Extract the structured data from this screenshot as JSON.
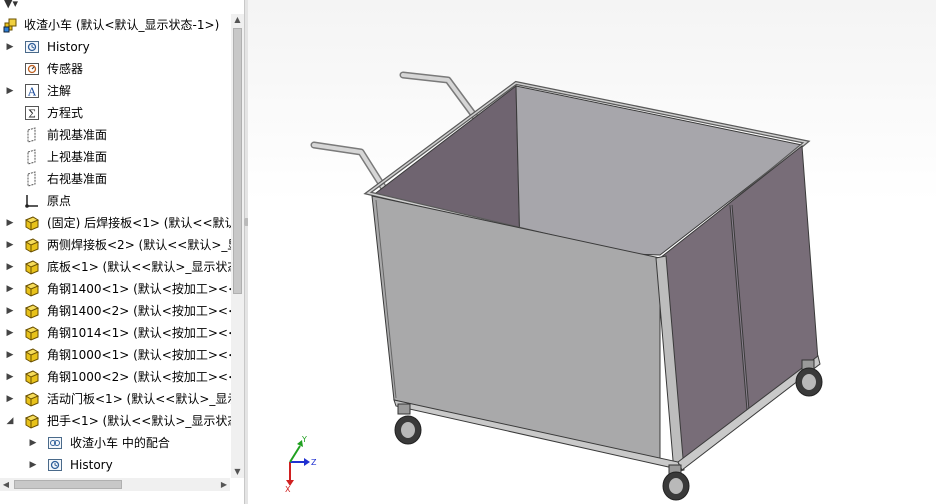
{
  "tree": {
    "root_label": "收渣小车  (默认<默认_显示状态-1>)",
    "items": [
      {
        "label": "History",
        "icon": "history-icon",
        "expander": true
      },
      {
        "label": "传感器",
        "icon": "sensor-icon",
        "expander": false
      },
      {
        "label": "注解",
        "icon": "annotation-icon",
        "expander": true
      },
      {
        "label": "方程式",
        "icon": "equation-icon",
        "expander": false
      },
      {
        "label": "前视基准面",
        "icon": "plane-icon",
        "expander": false
      },
      {
        "label": "上视基准面",
        "icon": "plane-icon",
        "expander": false
      },
      {
        "label": "右视基准面",
        "icon": "plane-icon",
        "expander": false
      },
      {
        "label": "原点",
        "icon": "origin-icon",
        "expander": false
      },
      {
        "label": "(固定) 后焊接板<1> (默认<<默认",
        "icon": "part-icon",
        "expander": true
      },
      {
        "label": "两侧焊接板<2> (默认<<默认>_显",
        "icon": "part-icon",
        "expander": true
      },
      {
        "label": "底板<1> (默认<<默认>_显示状态",
        "icon": "part-icon",
        "expander": true
      },
      {
        "label": "角钢1400<1> (默认<按加工><<",
        "icon": "part-icon",
        "expander": true
      },
      {
        "label": "角钢1400<2> (默认<按加工><<",
        "icon": "part-icon",
        "expander": true
      },
      {
        "label": "角钢1014<1> (默认<按加工><<",
        "icon": "part-icon",
        "expander": true
      },
      {
        "label": "角钢1000<1> (默认<按加工><<",
        "icon": "part-icon",
        "expander": true
      },
      {
        "label": "角钢1000<2> (默认<按加工><<",
        "icon": "part-icon",
        "expander": true
      },
      {
        "label": "活动门板<1> (默认<<默认>_显示",
        "icon": "part-icon",
        "expander": true
      },
      {
        "label": "把手<1> (默认<<默认>_显示状态",
        "icon": "part-icon",
        "expander": true,
        "expanded": true
      }
    ],
    "subitems": [
      {
        "label": "收渣小车 中的配合",
        "icon": "mates-icon"
      },
      {
        "label": "History",
        "icon": "history-icon"
      }
    ]
  },
  "triad": {
    "x": "X",
    "y": "Y",
    "z": "Z"
  },
  "colors": {
    "part_yellow": "#e8c21a",
    "panel_gray": "#a9a9aa",
    "inner_purple": "#6f6470",
    "frame_gray": "#c9c9c9",
    "axis_x": "#d02020",
    "axis_y": "#20a020",
    "axis_z": "#2030d0"
  }
}
